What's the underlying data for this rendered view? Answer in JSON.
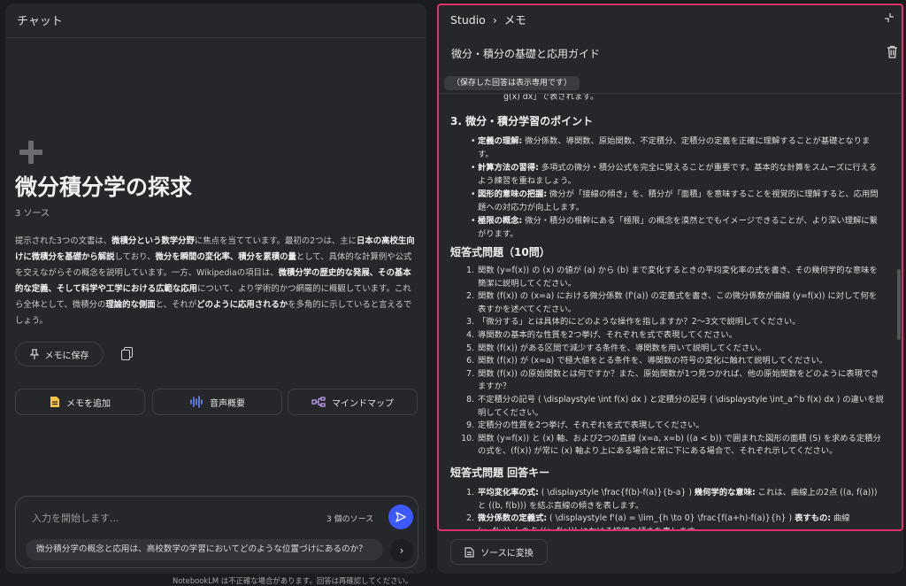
{
  "chat": {
    "title": "チャット",
    "notebook_title": "微分積分学の探求",
    "source_count": "3 ソース",
    "summary": {
      "p1": "提示された3つの文書は、",
      "b1": "微積分という数学分野",
      "p2": "に焦点を当てています。最初の2つは、主に",
      "b2": "日本の高校生向けに微積分を基礎から解説",
      "p3": "しており、",
      "b3": "微分を瞬間の変化率、積分を累積の量",
      "p4": "として、具体的な計算例や公式を交えながらその概念を説明しています。一方、Wikipediaの項目は、",
      "b4": "微積分学の歴史的な発展、その基本的な定義、そして科学や工学における広範な応用",
      "p5": "について、より学術的かつ網羅的に概観しています。これら全体として、微積分の",
      "b5": "理論的な側面",
      "p6": "と、それが",
      "b6": "どのように応用されるか",
      "p7": "を多角的に示していると言えるでしょう。"
    },
    "save_memo_label": "メモに保存",
    "actions": {
      "add_memo": "メモを追加",
      "audio": "音声概要",
      "mindmap": "マインドマップ"
    },
    "input_placeholder": "入力を開始します...",
    "input_source_count": "3 個のソース",
    "suggestion": "微分積分学の概念と応用は、高校数学の学習においてどのような位置づけにあるのか？",
    "footer": "NotebookLM は不正確な場合があります。回答は再確認してください。"
  },
  "studio": {
    "breadcrumb_root": "Studio",
    "breadcrumb_sep": "›",
    "breadcrumb_current": "メモ",
    "memo_title": "微分・積分の基礎と応用ガイド",
    "readonly_badge": "（保存した回答は表示専用です）",
    "partial_line": "g(x) dx」で表されます。",
    "section3": {
      "heading": "3. 微分・積分学習のポイント",
      "items": [
        {
          "b": "定義の理解:",
          "t": " 微分係数、導関数、原始関数、不定積分、定積分の定義を正確に理解することが基礎となります。"
        },
        {
          "b": "計算方法の習得:",
          "t": " 多項式の微分・積分公式を完全に覚えることが重要です。基本的な計算をスムーズに行えるよう練習を重ねましょう。"
        },
        {
          "b": "図形的意味の把握:",
          "t": " 微分が「接線の傾き」を、積分が「面積」を意味することを視覚的に理解すると、応用問題への対応力が向上します。"
        },
        {
          "b": "極限の概念:",
          "t": " 微分・積分の根幹にある「極限」の概念を漠然とでもイメージできることが、より深い理解に繋がります。"
        }
      ]
    },
    "short_answer": {
      "heading": "短答式問題（10問）",
      "items": [
        {
          "n": "1.",
          "t": "関数 (y=f(x)) の (x) の値が (a) から (b) まで変化するときの平均変化率の式を書き、その幾何学的な意味を簡潔に説明してください。"
        },
        {
          "n": "2.",
          "t": "関数 (f(x)) の (x=a) における微分係数 (f'(a)) の定義式を書き、この微分係数が曲線 (y=f(x)) に対して何を表すかを述べてください。"
        },
        {
          "n": "3.",
          "t": "「微分する」とは具体的にどのような操作を指しますか？2〜3文で説明してください。"
        },
        {
          "n": "4.",
          "t": "導関数の基本的な性質を2つ挙げ、それぞれを式で表現してください。"
        },
        {
          "n": "5.",
          "t": "関数 (f(x)) がある区間で減少する条件を、導関数を用いて説明してください。"
        },
        {
          "n": "6.",
          "t": "関数 (f(x)) が (x=a) で極大値をとる条件を、導関数の符号の変化に触れて説明してください。"
        },
        {
          "n": "7.",
          "t": "関数 (f(x)) の原始関数とは何ですか？また、原始関数が1つ見つかれば、他の原始関数をどのように表現できますか？"
        },
        {
          "n": "8.",
          "t": "不定積分の記号 ( \\displaystyle \\int f(x) dx ) と定積分の記号 ( \\displaystyle \\int_a^b f(x) dx ) の違いを説明してください。"
        },
        {
          "n": "9.",
          "t": "定積分の性質を2つ挙げ、それぞれを式で表現してください。"
        },
        {
          "n": "10.",
          "t": "関数 (y=f(x)) と (x) 軸、および2つの直線 (x=a, x=b) ((a < b)) で囲まれた図形の面積 (S) を求める定積分の式を、(f(x)) が常に (x) 軸より上にある場合と常に下にある場合で、それぞれ示してください。"
        }
      ]
    },
    "answer_key": {
      "heading": "短答式問題 回答キー",
      "items": [
        {
          "n": "1.",
          "b1": "平均変化率の式:",
          "t1": " ( \\displaystyle \\frac{f(b)-f(a)}{b-a} ) ",
          "b2": "幾何学的な意味:",
          "t2": " これは、曲線上の2点 ((a, f(a))) と ((b, f(b))) を結ぶ直線の傾きを表します。"
        },
        {
          "n": "2.",
          "b1": "微分係数の定義式:",
          "t1": " ( \\displaystyle f'(a) = \\lim_{h \\to 0} \\frac{f(a+h)-f(a)}{h} ) ",
          "b2": "表すもの:",
          "t2": " 曲線 (y=f(x)) 上の点 ((a, f(a))) における接線の傾きを表します。"
        }
      ]
    },
    "convert_label": "ソースに変換"
  }
}
